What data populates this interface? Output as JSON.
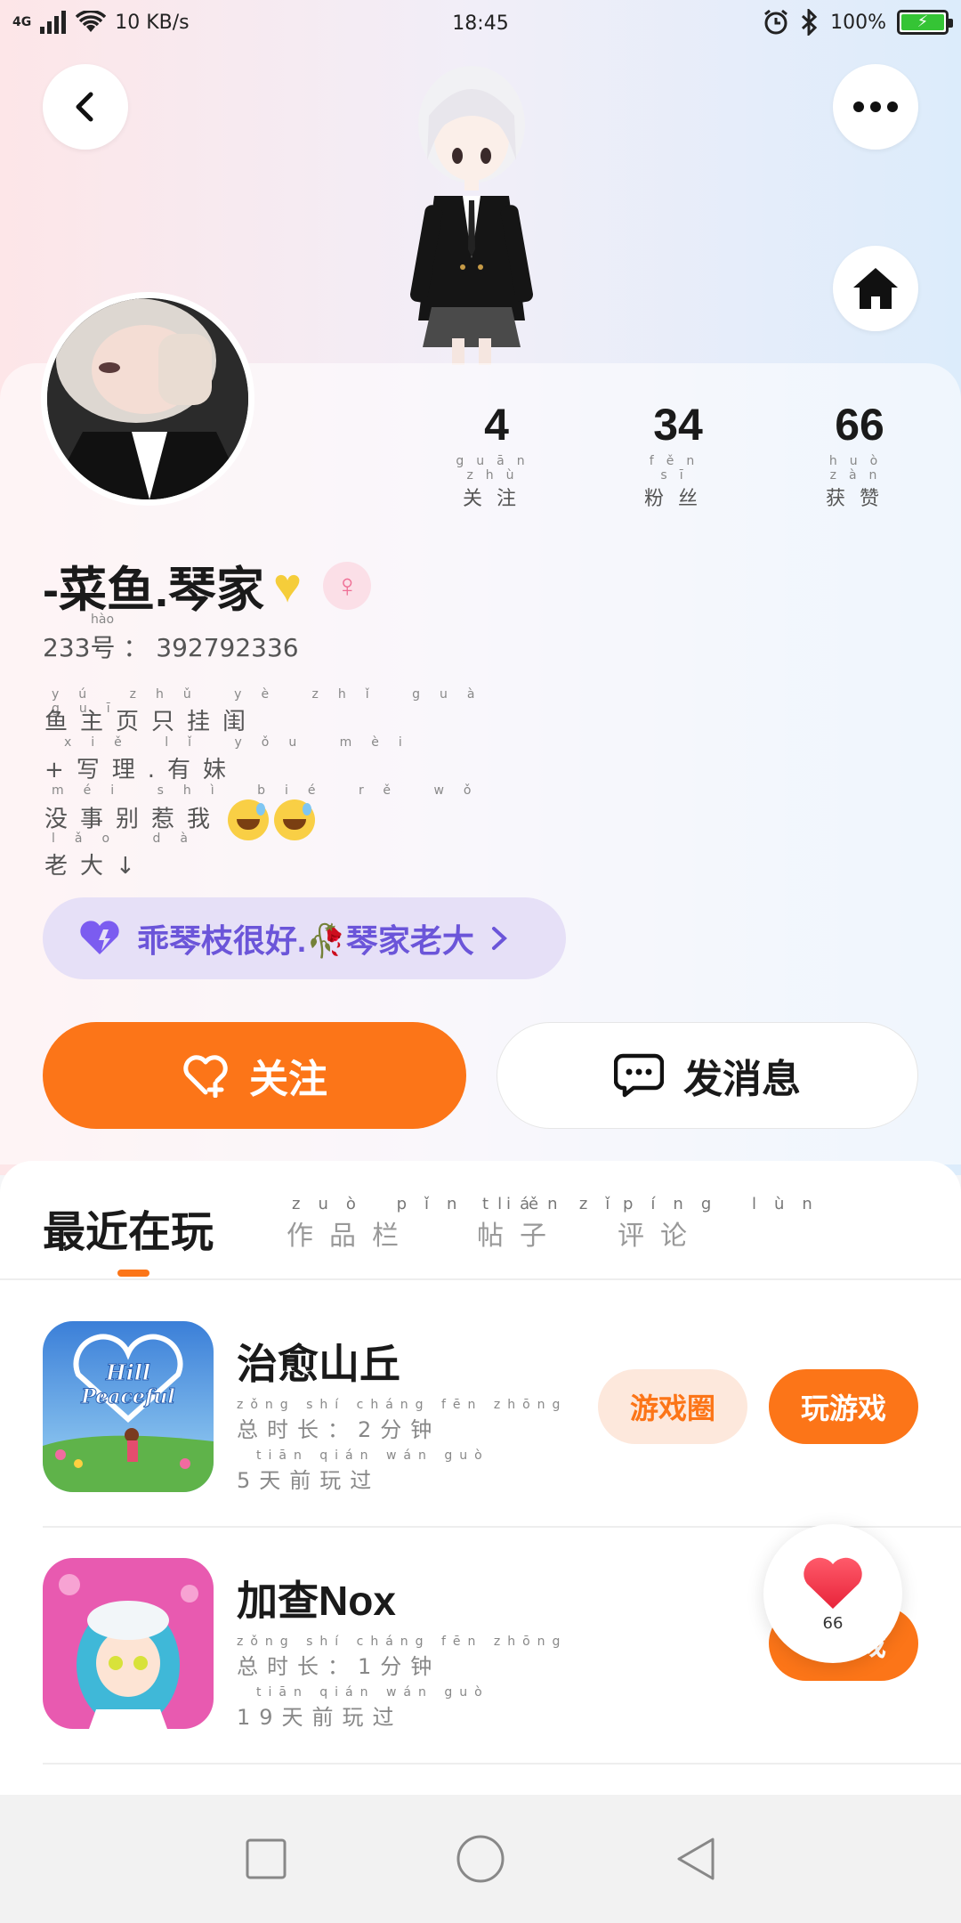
{
  "status_bar": {
    "network": "4G",
    "speed": "10 KB/s",
    "time": "18:45",
    "battery": "100%"
  },
  "profile": {
    "username": "-菜鱼.琴家",
    "uid_label": "233号",
    "uid_pinyin": "hào",
    "uid_value": "392792336",
    "stats": [
      {
        "value": "4",
        "pinyin": "guān zhù",
        "label": "关注"
      },
      {
        "value": "34",
        "pinyin": "fěn sī",
        "label": "粉丝"
      },
      {
        "value": "66",
        "pinyin": "huò zàn",
        "label": "获赞"
      }
    ],
    "bio": [
      {
        "pinyin": "yú zhǔ yè zhǐ guà guī",
        "text": "鱼主页只挂闺"
      },
      {
        "pinyin": "xiě lǐ yǒu mèi",
        "text": "+写理.有妹"
      },
      {
        "pinyin": "méi shì bié rě wǒ",
        "text": "没事别惹我"
      },
      {
        "pinyin": "lǎo dà",
        "text": "老大↓"
      }
    ],
    "tag": "乖琴枝很好.🥀琴家老大"
  },
  "actions": {
    "follow": "关注",
    "message": "发消息"
  },
  "tabs": [
    {
      "label": "最近在玩",
      "pinyin": ""
    },
    {
      "label": "作品栏",
      "pinyin": "zuò pǐn lán"
    },
    {
      "label": "帖子",
      "pinyin": "tiě zǐ"
    },
    {
      "label": "评论",
      "pinyin": "píng lùn"
    }
  ],
  "games": [
    {
      "title": "治愈山丘",
      "icon_text": "Hill Peaceful",
      "duration_pinyin": "zǒng shí cháng   fēn zhōng",
      "duration": "总时长：2分钟",
      "last_pinyin": "tiān qián wán guò",
      "last_played": "5天前玩过",
      "circle_label": "游戏圈",
      "play_label": "玩游戏"
    },
    {
      "title": "加查Nox",
      "icon_text": "",
      "duration_pinyin": "zǒng shí cháng   fēn zhōng",
      "duration": "总时长：1分钟",
      "last_pinyin": "tiān qián wán guò",
      "last_played": "19天前玩过",
      "circle_label": "",
      "play_label": "玩游戏"
    }
  ],
  "floating_like": {
    "count": "66"
  },
  "colors": {
    "accent": "#fc7518",
    "tag_bg": "#e6e0f7",
    "tag_text": "#6b55d9",
    "gender": "#ef6f95"
  },
  "icons": [
    "back-icon",
    "more-icon",
    "home-icon",
    "purple-heart-icon",
    "chevron-right-icon",
    "heart-plus-icon",
    "chat-bubble-icon",
    "female-icon",
    "heart-icon"
  ]
}
